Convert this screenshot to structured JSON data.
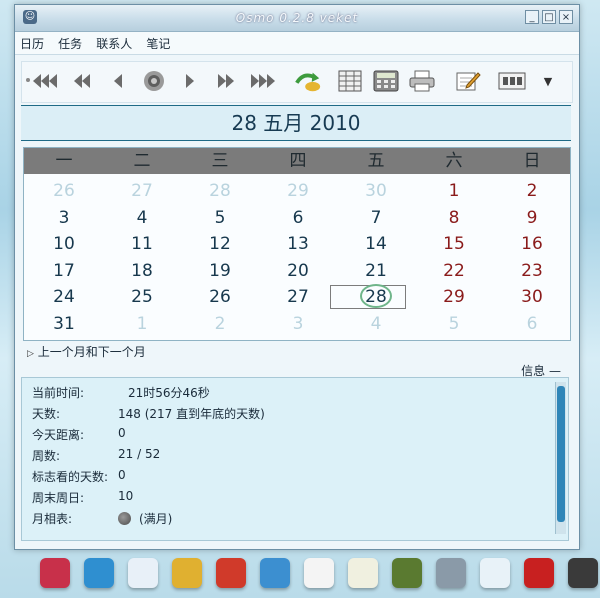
{
  "window": {
    "title": "Osmo 0.2.8   veket",
    "min_glyph": "_",
    "max_glyph": "□",
    "close_glyph": "×"
  },
  "menu": [
    "日历",
    "任务",
    "联系人",
    "笔记"
  ],
  "toolbar": {
    "buttons": [
      {
        "name": "prev-year-button",
        "icon": "triple-left-arrow-icon"
      },
      {
        "name": "prev-month-button",
        "icon": "double-left-arrow-icon"
      },
      {
        "name": "prev-day-button",
        "icon": "left-arrow-icon"
      },
      {
        "name": "today-button",
        "icon": "target-icon"
      },
      {
        "name": "next-day-button",
        "icon": "right-arrow-icon"
      },
      {
        "name": "next-month-button",
        "icon": "double-right-arrow-icon"
      },
      {
        "name": "next-year-button",
        "icon": "triple-right-arrow-icon"
      },
      {
        "name": "jump-to-date-button",
        "icon": "jump-arrow-icon"
      },
      {
        "name": "full-year-button",
        "icon": "grid-calendar-icon"
      },
      {
        "name": "calculator-button",
        "icon": "calculator-icon"
      },
      {
        "name": "print-button",
        "icon": "printer-icon"
      },
      {
        "name": "edit-note-button",
        "icon": "notepad-pencil-icon"
      },
      {
        "name": "options-button",
        "icon": "settings-panel-icon"
      },
      {
        "name": "more-dropdown-button",
        "icon": "chevron-down-icon"
      }
    ]
  },
  "date_header": "28 五月 2010",
  "calendar": {
    "weekdays": [
      "一",
      "二",
      "三",
      "四",
      "五",
      "六",
      "日"
    ],
    "weeks": [
      [
        {
          "d": "26",
          "t": "other"
        },
        {
          "d": "27",
          "t": "other"
        },
        {
          "d": "28",
          "t": "other"
        },
        {
          "d": "29",
          "t": "other"
        },
        {
          "d": "30",
          "t": "other"
        },
        {
          "d": "1",
          "t": "wkend"
        },
        {
          "d": "2",
          "t": "wkend"
        }
      ],
      [
        {
          "d": "3",
          "t": "norm"
        },
        {
          "d": "4",
          "t": "norm"
        },
        {
          "d": "5",
          "t": "norm"
        },
        {
          "d": "6",
          "t": "norm"
        },
        {
          "d": "7",
          "t": "norm"
        },
        {
          "d": "8",
          "t": "wkend"
        },
        {
          "d": "9",
          "t": "wkend"
        }
      ],
      [
        {
          "d": "10",
          "t": "norm"
        },
        {
          "d": "11",
          "t": "norm"
        },
        {
          "d": "12",
          "t": "norm"
        },
        {
          "d": "13",
          "t": "norm"
        },
        {
          "d": "14",
          "t": "norm"
        },
        {
          "d": "15",
          "t": "wkend"
        },
        {
          "d": "16",
          "t": "wkend"
        }
      ],
      [
        {
          "d": "17",
          "t": "norm"
        },
        {
          "d": "18",
          "t": "norm"
        },
        {
          "d": "19",
          "t": "norm"
        },
        {
          "d": "20",
          "t": "norm"
        },
        {
          "d": "21",
          "t": "norm"
        },
        {
          "d": "22",
          "t": "wkend"
        },
        {
          "d": "23",
          "t": "wkend"
        }
      ],
      [
        {
          "d": "24",
          "t": "norm"
        },
        {
          "d": "25",
          "t": "norm"
        },
        {
          "d": "26",
          "t": "norm"
        },
        {
          "d": "27",
          "t": "norm"
        },
        {
          "d": "28",
          "t": "today"
        },
        {
          "d": "29",
          "t": "wkend"
        },
        {
          "d": "30",
          "t": "wkend"
        }
      ],
      [
        {
          "d": "31",
          "t": "norm"
        },
        {
          "d": "1",
          "t": "other"
        },
        {
          "d": "2",
          "t": "other"
        },
        {
          "d": "3",
          "t": "other"
        },
        {
          "d": "4",
          "t": "other"
        },
        {
          "d": "5",
          "t": "other"
        },
        {
          "d": "6",
          "t": "other"
        }
      ]
    ]
  },
  "expander_label": "上一个月和下一个月",
  "info": {
    "label": "信息",
    "rows": [
      {
        "k": "当前时间:",
        "v": "21时56分46秒"
      },
      {
        "k": "天数:",
        "v": "148 (217 直到年底的天数)"
      },
      {
        "k": "今天距离:",
        "v": "0"
      },
      {
        "k": "周数:",
        "v": "21 / 52"
      },
      {
        "k": "标志看的天数:",
        "v": "0"
      },
      {
        "k": "周末周日:",
        "v": "10"
      },
      {
        "k": "月相表:",
        "v": "(满月)"
      }
    ]
  },
  "colors": {
    "weekend": "#8a1b1b",
    "normal": "#17384d",
    "other_month": "#b9d3de",
    "header_bg": "#7b7b7b",
    "scroll_thumb": "#2f86b8"
  },
  "dock": [
    {
      "icon": "flower-app-icon",
      "color": "#c8304a"
    },
    {
      "icon": "lifebuoy-icon",
      "color": "#2f8fd0"
    },
    {
      "icon": "draw-pen-icon",
      "color": "#e8f0f8"
    },
    {
      "icon": "music-gramophone-icon",
      "color": "#e0b030"
    },
    {
      "icon": "red-network-icon",
      "color": "#d03a2a"
    },
    {
      "icon": "search-globe-icon",
      "color": "#3c8fd0"
    },
    {
      "icon": "document-icon",
      "color": "#f4f4f4"
    },
    {
      "icon": "mail-pencil-icon",
      "color": "#f0f0e0"
    },
    {
      "icon": "photo-viewer-icon",
      "color": "#5a7a30"
    },
    {
      "icon": "hard-drive-icon",
      "color": "#8a9aa8"
    },
    {
      "icon": "calendar-app-icon",
      "color": "#e8f2f8"
    },
    {
      "icon": "help-icon",
      "color": "#c82020"
    },
    {
      "icon": "usb-device-icon",
      "color": "#3a3a3a"
    }
  ]
}
